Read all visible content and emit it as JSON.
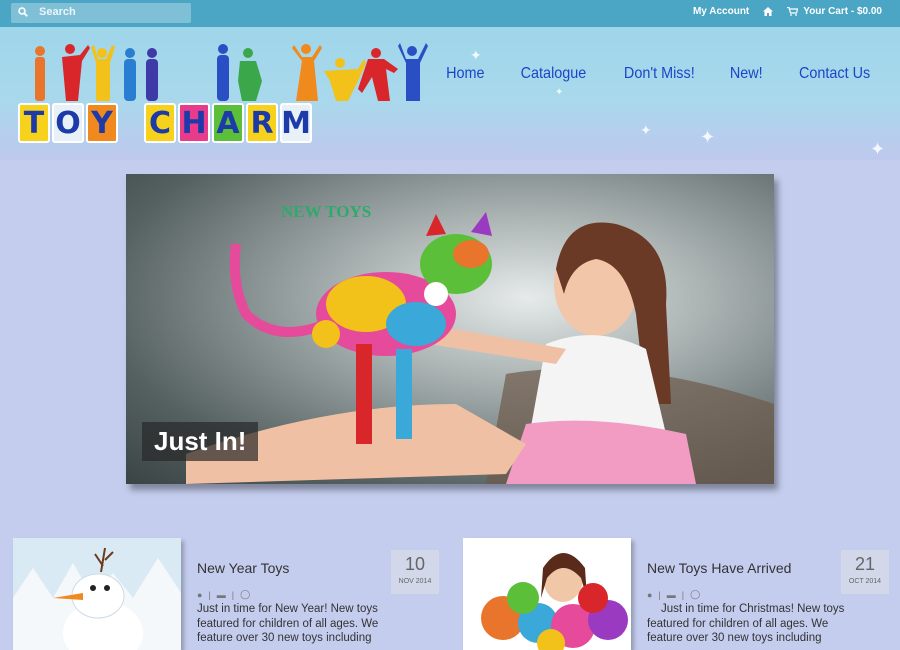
{
  "search": {
    "placeholder": "Search"
  },
  "toplinks": {
    "account": "My Account",
    "cart": "Your Cart - $0.00"
  },
  "logo": {
    "letters": [
      "T",
      "O",
      "Y",
      "",
      "C",
      "H",
      "A",
      "R",
      "M"
    ]
  },
  "nav": [
    "Home",
    "Catalogue",
    "Don't Miss!",
    "New!",
    "Contact Us"
  ],
  "hero": {
    "heading": "NEW TOYS",
    "caption": "Just In!"
  },
  "posts": [
    {
      "title": "New Year Toys",
      "day": "10",
      "month": "NOV 2014",
      "excerpt": "Just in time for New Year! New toys featured for children of all ages. We feature over 30 new toys including"
    },
    {
      "title": "New Toys Have Arrived",
      "day": "21",
      "month": "OCT 2014",
      "excerpt": "Just in time for Christmas! New toys featured for children of all ages. We feature over 30 new toys including"
    }
  ],
  "colors": {
    "topbar": "#4aa6c4",
    "nav": "#1b45c8",
    "page": "#c4cdee"
  }
}
